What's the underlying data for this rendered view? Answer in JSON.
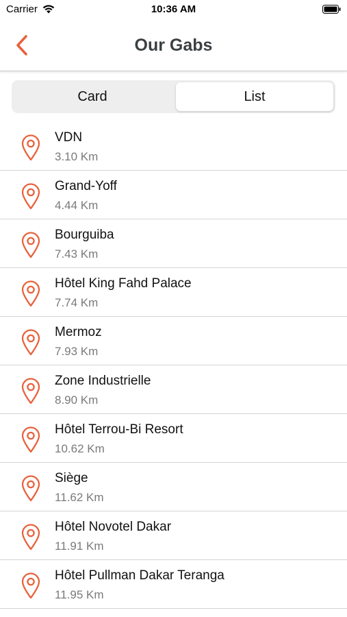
{
  "status": {
    "carrier": "Carrier",
    "time": "10:36 AM",
    "icons": [
      "wifi-icon",
      "battery-icon"
    ]
  },
  "nav": {
    "back_icon": "chevron-left-icon",
    "title": "Our Gabs"
  },
  "segments": {
    "card": "Card",
    "list": "List",
    "selected": "List"
  },
  "colors": {
    "accent": "#e8623c",
    "title": "#3b4043",
    "subtitle": "#7a7a7a"
  },
  "items": [
    {
      "name": "VDN",
      "distance": "3.10 Km"
    },
    {
      "name": "Grand-Yoff",
      "distance": "4.44 Km"
    },
    {
      "name": "Bourguiba",
      "distance": "7.43 Km"
    },
    {
      "name": "Hôtel King Fahd Palace",
      "distance": "7.74 Km"
    },
    {
      "name": "Mermoz",
      "distance": "7.93 Km"
    },
    {
      "name": "Zone Industrielle",
      "distance": "8.90 Km"
    },
    {
      "name": "Hôtel Terrou-Bi Resort",
      "distance": "10.62 Km"
    },
    {
      "name": "Siège",
      "distance": "11.62 Km"
    },
    {
      "name": "Hôtel Novotel Dakar",
      "distance": "11.91 Km"
    },
    {
      "name": "Hôtel Pullman Dakar Teranga",
      "distance": "11.95 Km"
    }
  ]
}
